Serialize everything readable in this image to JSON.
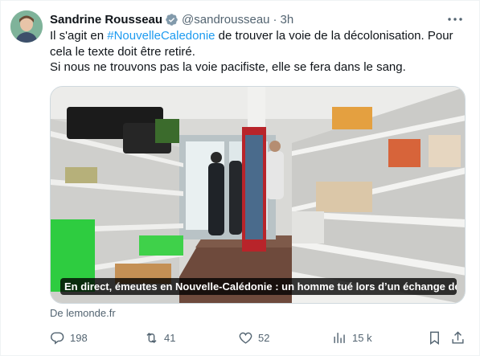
{
  "tweet": {
    "author_name": "Sandrine Rousseau",
    "handle": "@sandrousseau",
    "separator": "·",
    "time": "3h",
    "text_line1_pre": "Il s'agit en ",
    "hashtag": "#NouvelleCaledonie",
    "text_line1_post": " de trouver la voie de la décolonisation. Pour",
    "text_line2": "cela le texte doit être retiré.",
    "text_line3": "Si nous ne trouvons pas la voie pacifiste, elle se fera dans le sang."
  },
  "card": {
    "caption": "En direct, émeutes en Nouvelle-Calédonie : un homme tué lors d’un échange de...",
    "source": "De lemonde.fr"
  },
  "actions": {
    "replies": "198",
    "reposts": "41",
    "likes": "52",
    "views": "15 k"
  },
  "colors": {
    "accent": "#1d9bf0",
    "text": "#0f1419",
    "muted": "#536471"
  },
  "icons": [
    "verified-badge-icon",
    "more-icon",
    "reply-icon",
    "repost-icon",
    "like-icon",
    "views-icon",
    "bookmark-icon",
    "share-icon"
  ]
}
